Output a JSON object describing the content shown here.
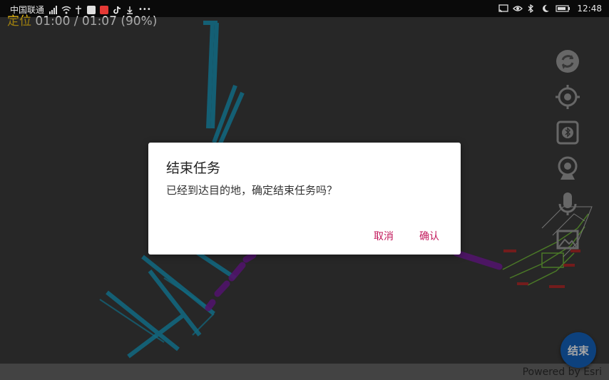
{
  "status_bar": {
    "carrier": "中国联通",
    "time": "12:48"
  },
  "location_label": {
    "prefix": "定位",
    "progress": "01:00 / 01:07 (90%)"
  },
  "map_controls": [
    {
      "name": "refresh",
      "icon": "refresh-icon"
    },
    {
      "name": "locate",
      "icon": "crosshair-icon"
    },
    {
      "name": "bluetooth",
      "icon": "bluetooth-icon"
    },
    {
      "name": "camera",
      "icon": "webcam-icon"
    },
    {
      "name": "voice",
      "icon": "microphone-icon"
    },
    {
      "name": "image",
      "icon": "image-icon"
    }
  ],
  "dialog": {
    "title": "结束任务",
    "message": "已经到达目的地，确定结束任务吗？",
    "cancel_label": "取消",
    "confirm_label": "确认"
  },
  "end_button": {
    "label": "结束"
  },
  "attribution": "Powered by Esri",
  "colors": {
    "accent": "#c2185b",
    "fab": "#1565c0",
    "route_cyan": "#1aa3c8",
    "route_purple": "#7b1fa2",
    "location_prefix": "#f2c318"
  }
}
